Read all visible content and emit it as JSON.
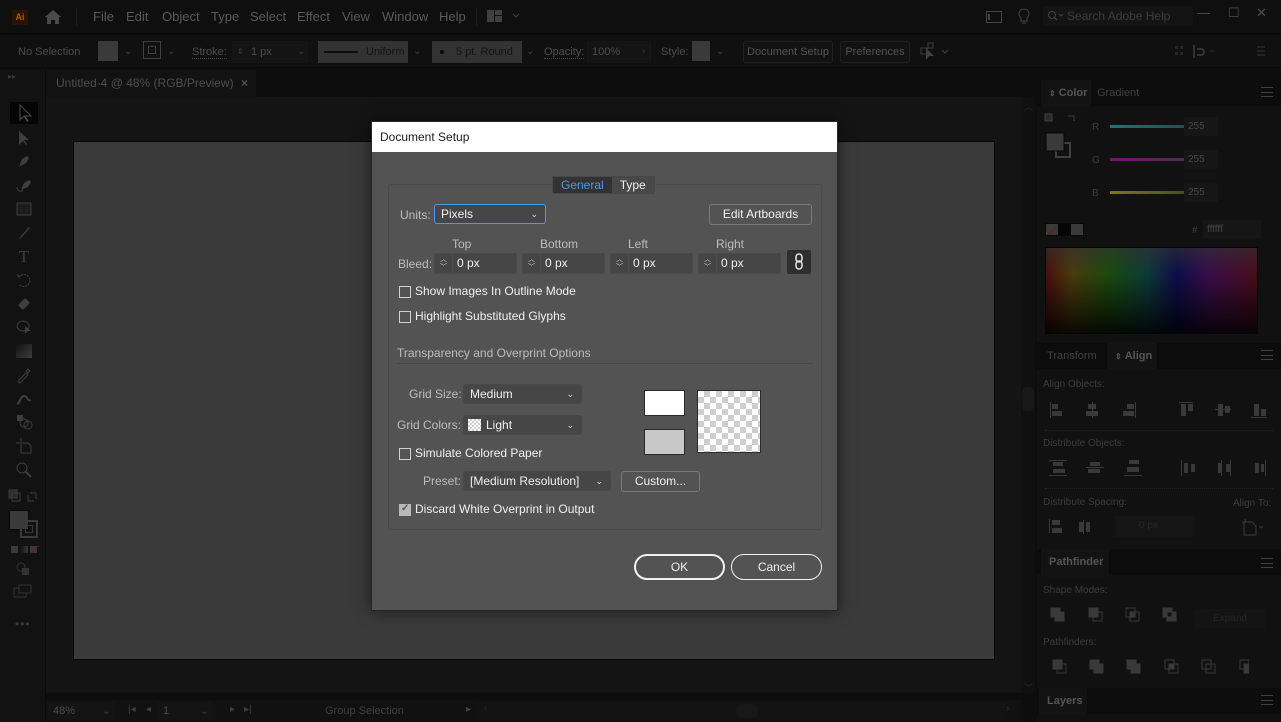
{
  "app": {
    "logo": "Ai",
    "menu": [
      "File",
      "Edit",
      "Object",
      "Type",
      "Select",
      "Effect",
      "View",
      "Window",
      "Help"
    ],
    "help_search_placeholder": "Search Adobe Help"
  },
  "control_bar": {
    "selection_status": "No Selection",
    "stroke_label": "Stroke:",
    "stroke_value": "1 px",
    "stroke_profile": "Uniform",
    "brush": "5 pt. Round",
    "opacity_label": "Opacity:",
    "opacity_value": "100%",
    "style_label": "Style:",
    "document_setup": "Document Setup",
    "preferences": "Preferences"
  },
  "document_tab": {
    "title": "Untitled-4 @ 48% (RGB/Preview)",
    "close": "×"
  },
  "tools": [
    "selection-tool",
    "direct-selection-tool",
    "pen-tool",
    "curvature-tool",
    "rectangle-tool",
    "paintbrush-tool",
    "type-tool",
    "rotate-tool",
    "eraser-tool",
    "lasso-tool",
    "gradient-tool",
    "eyedropper-tool",
    "blend-tool",
    "shape-builder-tool",
    "artboard-tool",
    "zoom-tool"
  ],
  "status_bar": {
    "zoom": "48%",
    "artboard_number": "1",
    "tool_name": "Group Selection"
  },
  "color_panel": {
    "tabs": [
      "Color",
      "Gradient"
    ],
    "active_tab": "Color",
    "channels": [
      {
        "label": "R",
        "value": "255",
        "color": "#1aa7a7"
      },
      {
        "label": "G",
        "value": "255",
        "color": "#a11aa1"
      },
      {
        "label": "B",
        "value": "255",
        "color": "#a6a61a"
      }
    ],
    "hex_label": "#",
    "hex_value": "ffffff"
  },
  "align_panel": {
    "tabs": [
      "Transform",
      "Align"
    ],
    "active_tab": "Align",
    "align_objects_label": "Align Objects:",
    "distribute_objects_label": "Distribute Objects:",
    "distribute_spacing_label": "Distribute Spacing:",
    "spacing_value": "0 px",
    "align_to_label": "Align To:"
  },
  "pathfinder_panel": {
    "title": "Pathfinder",
    "shape_modes_label": "Shape Modes:",
    "expand_label": "Expand",
    "pathfinders_label": "Pathfinders:"
  },
  "layers_panel": {
    "title": "Layers"
  },
  "dialog": {
    "title": "Document Setup",
    "tabs": [
      "General",
      "Type"
    ],
    "active_tab": "General",
    "units_label": "Units:",
    "units_value": "Pixels",
    "edit_artboards": "Edit Artboards",
    "bleed_label": "Bleed:",
    "bleed": [
      {
        "label": "Top",
        "value": "0 px"
      },
      {
        "label": "Bottom",
        "value": "0 px"
      },
      {
        "label": "Left",
        "value": "0 px"
      },
      {
        "label": "Right",
        "value": "0 px"
      }
    ],
    "show_images_outline": {
      "label": "Show Images In Outline Mode",
      "checked": false
    },
    "highlight_glyphs": {
      "label": "Highlight Substituted Glyphs",
      "checked": false
    },
    "transparency_section": "Transparency and Overprint Options",
    "grid_size_label": "Grid Size:",
    "grid_size_value": "Medium",
    "grid_colors_label": "Grid Colors:",
    "grid_colors_value": "Light",
    "simulate_paper": {
      "label": "Simulate Colored Paper",
      "checked": false
    },
    "preset_label": "Preset:",
    "preset_value": "[Medium Resolution]",
    "custom_button": "Custom...",
    "discard_overprint": {
      "label": "Discard White Overprint in Output",
      "checked": true
    },
    "ok": "OK",
    "cancel": "Cancel"
  }
}
